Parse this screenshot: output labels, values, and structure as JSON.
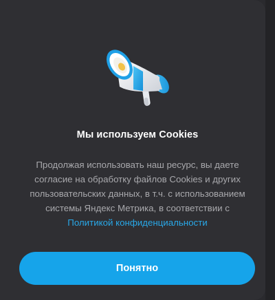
{
  "dialog": {
    "icon": "megaphone-icon",
    "title": "Мы используем Cookies",
    "body_lines": [
      "Продолжая использовать наш ресурс, вы даете",
      "согласие на обработку файлов Cookies и других",
      "пользовательских данных, в т.ч. с использованием",
      "системы Яндекс Метрика, в соответствии с"
    ],
    "policy_link": "Политикой конфиденциальности",
    "accept_button": "Понятно"
  },
  "colors": {
    "background": "#2f2f33",
    "accent": "#16a4ea",
    "link": "#29a8e8",
    "text_secondary": "#a9a9ad"
  }
}
